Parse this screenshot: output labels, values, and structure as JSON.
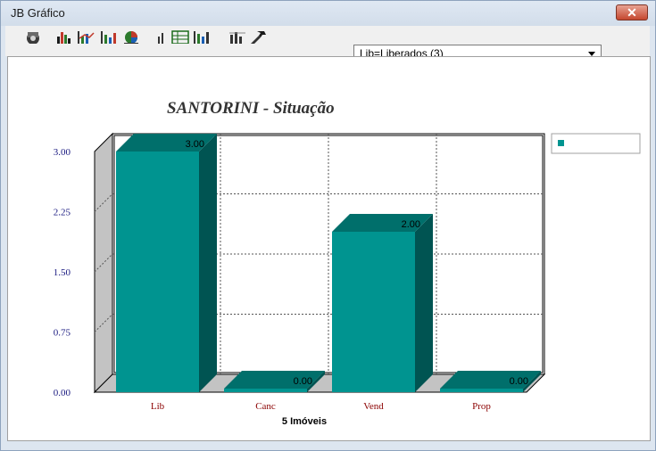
{
  "window": {
    "title": "JB Gráfico",
    "close_label": "✕"
  },
  "toolbar": {
    "icons": [
      "globe-3d-icon",
      "bar-chart-icon",
      "line-bar-chart-icon",
      "stacked-chart-icon",
      "pie-chart-icon",
      "small-bar-icon",
      "table-chart-icon",
      "column-chart-icon",
      "grid-chart-icon",
      "tools-icon"
    ],
    "filter_select": {
      "value": "Lib=Liberados (3)"
    }
  },
  "colors": {
    "bar_front": "#009490",
    "bar_top": "#006f6b",
    "bar_side": "#005452",
    "wall": "#c3c3c3",
    "axis_text": "#1a1a80",
    "cat_text": "#8b0000"
  },
  "chart_data": {
    "type": "bar",
    "title": "SANTORINI - Situação",
    "xlabel": "5 Imóveis",
    "ylabel": "",
    "categories": [
      "Lib",
      "Canc",
      "Vend",
      "Prop"
    ],
    "values": [
      3,
      0,
      2,
      0
    ],
    "value_labels": [
      "3.00",
      "0.00",
      "2.00",
      "0.00"
    ],
    "y_ticks": [
      "3.00",
      "2.25",
      "1.50",
      "0.75",
      "0.00"
    ],
    "ylim": [
      0,
      3
    ],
    "grid": true,
    "legend_position": "top-right",
    "legend_entries": [
      ""
    ]
  }
}
